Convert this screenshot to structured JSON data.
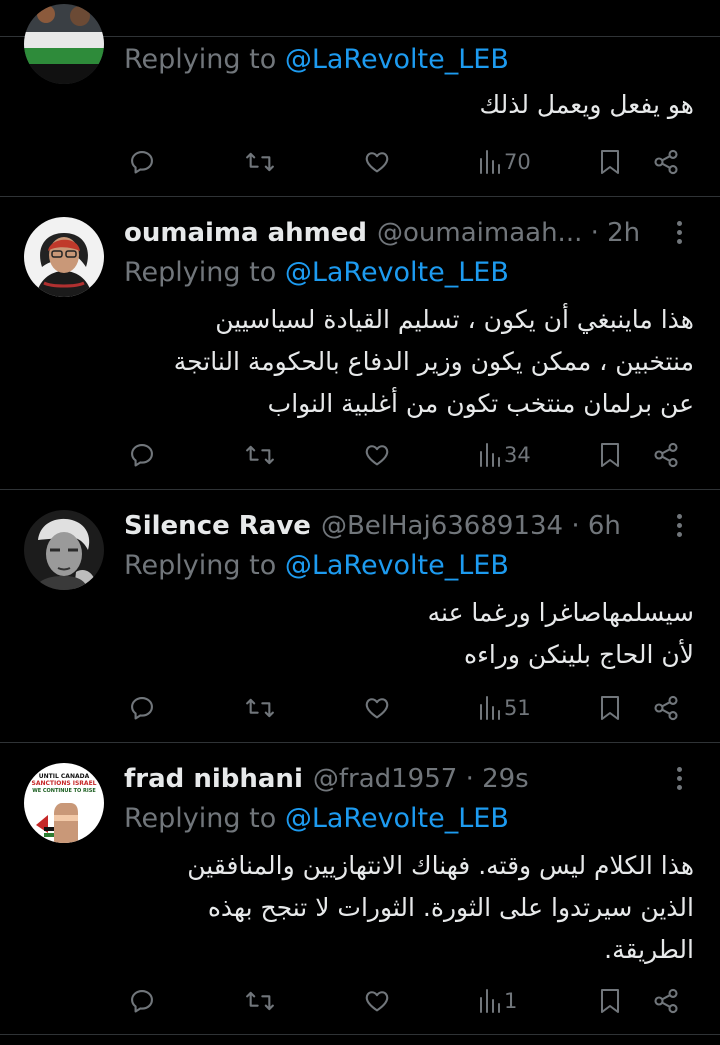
{
  "tweets": [
    {
      "reply_prefix": "Replying to",
      "reply_to": "@LaRevolte_LEB",
      "body_lines": [
        "هو يفعل ويعمل لذلك"
      ],
      "views": "70"
    },
    {
      "name": "oumaima ahmed",
      "handle": "@oumaimaah... · 2h",
      "reply_prefix": "Replying to",
      "reply_to": "@LaRevolte_LEB",
      "body_lines": [
        "هذا ماينبغي أن يكون ، تسليم القيادة لسياسيين",
        "منتخبين ، ممكن يكون وزير الدفاع بالحكومة الناتجة",
        "عن برلمان منتخب تكون من أغلبية النواب"
      ],
      "views": "34"
    },
    {
      "name": "Silence Rave",
      "handle": "@BelHaj63689134 · 6h",
      "reply_prefix": "Replying to",
      "reply_to": "@LaRevolte_LEB",
      "body_lines": [
        "سيسلمهاصاغرا ورغما عنه",
        "لأن الحاج بلينكن وراءه"
      ],
      "views": "51"
    },
    {
      "name": "frad nibhani",
      "handle": "@frad1957 · 29s",
      "reply_prefix": "Replying to",
      "reply_to": "@LaRevolte_LEB",
      "body_lines": [
        "هذا الكلام ليس وقته. فهناك الانتهازيين والمنافقين",
        "الذين سيرتدوا على الثورة. الثورات لا تنجح بهذه",
        "الطريقة."
      ],
      "views": "1",
      "avatar_text": [
        "UNTIL CANADA",
        "SANCTIONS ISRAEL",
        "WE CONTINUE TO RISE"
      ]
    }
  ],
  "colors": {
    "background": "#000000",
    "text": "#e7e9ea",
    "muted": "#71767b",
    "link": "#1d9bf0",
    "divider": "#2f3336"
  },
  "icons": [
    "reply-icon",
    "retweet-icon",
    "like-icon",
    "views-icon",
    "bookmark-icon",
    "share-icon",
    "more-icon"
  ]
}
